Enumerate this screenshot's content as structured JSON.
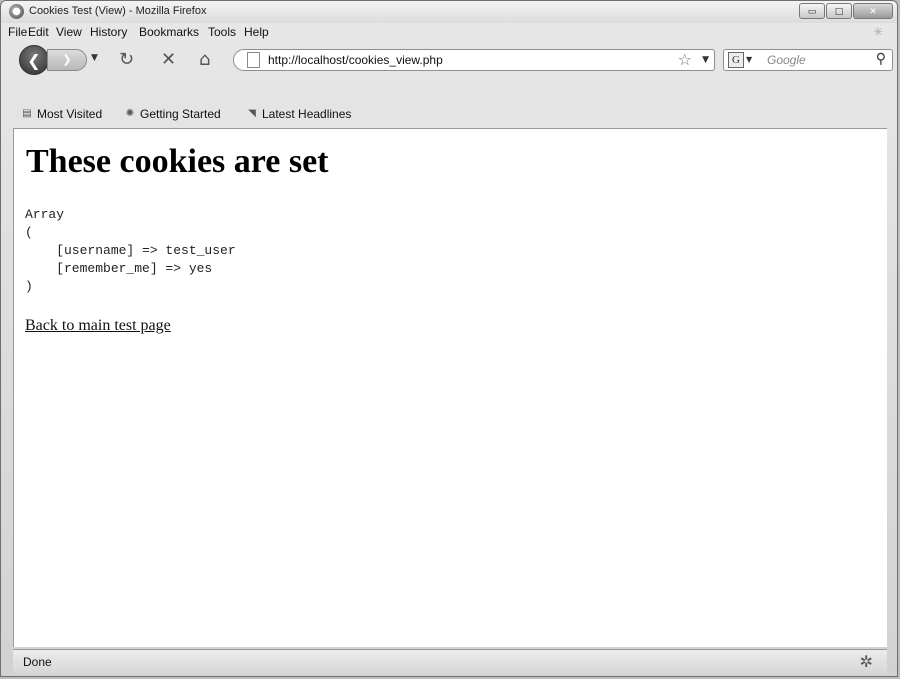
{
  "window": {
    "title": "Cookies Test (View) - Mozilla Firefox",
    "controls": {
      "minimize": "▭",
      "maximize": "□",
      "close": "✕"
    }
  },
  "menu": {
    "items": [
      "File",
      "Edit",
      "View",
      "History",
      "Bookmarks",
      "Tools",
      "Help"
    ]
  },
  "toolbar": {
    "url": "http://localhost/cookies_view.php",
    "search_placeholder": "Google",
    "search_engine_letter": "G"
  },
  "bookmarks": [
    {
      "label": "Most Visited",
      "icon": "most-visited-icon"
    },
    {
      "label": "Getting Started",
      "icon": "firefox-icon"
    },
    {
      "label": "Latest Headlines",
      "icon": "rss-feed-icon"
    }
  ],
  "page": {
    "heading": "These cookies are set",
    "output": "Array\n(\n    [username] => test_user\n    [remember_me] => yes\n)",
    "back_link": "Back to main test page"
  },
  "status": {
    "text": "Done"
  }
}
